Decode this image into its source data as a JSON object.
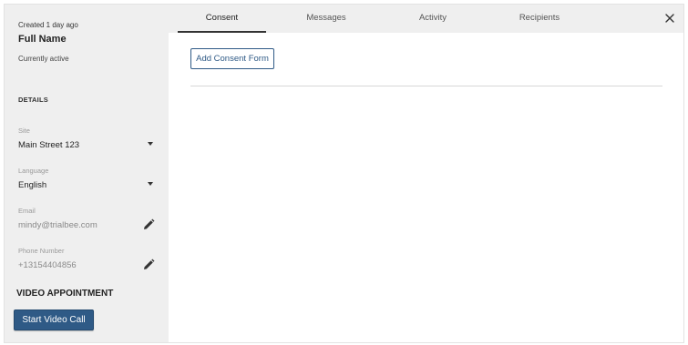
{
  "profile": {
    "created": "Created 1 day ago",
    "name": "Full Name",
    "status": "Currently active"
  },
  "details": {
    "heading": "DETAILS",
    "site": {
      "label": "Site",
      "value": "Main Street 123"
    },
    "language": {
      "label": "Language",
      "value": "English"
    },
    "email": {
      "label": "Email",
      "value": "mindy@trialbee.com"
    },
    "phone": {
      "label": "Phone Number",
      "value": "+13154404856"
    }
  },
  "video": {
    "heading": "VIDEO APPOINTMENT",
    "button_label": "Start Video Call"
  },
  "tabs": [
    {
      "label": "Consent",
      "active": true
    },
    {
      "label": "Messages",
      "active": false
    },
    {
      "label": "Activity",
      "active": false
    },
    {
      "label": "Recipients",
      "active": false
    }
  ],
  "consent": {
    "add_button_label": "Add Consent Form"
  },
  "icons": {
    "close": "close-icon",
    "dropdown": "chevron-down-icon",
    "edit": "pencil-icon"
  },
  "colors": {
    "primary": "#2f5a86",
    "sidebar_bg": "#efefef",
    "tabbar_bg": "#efefef"
  }
}
